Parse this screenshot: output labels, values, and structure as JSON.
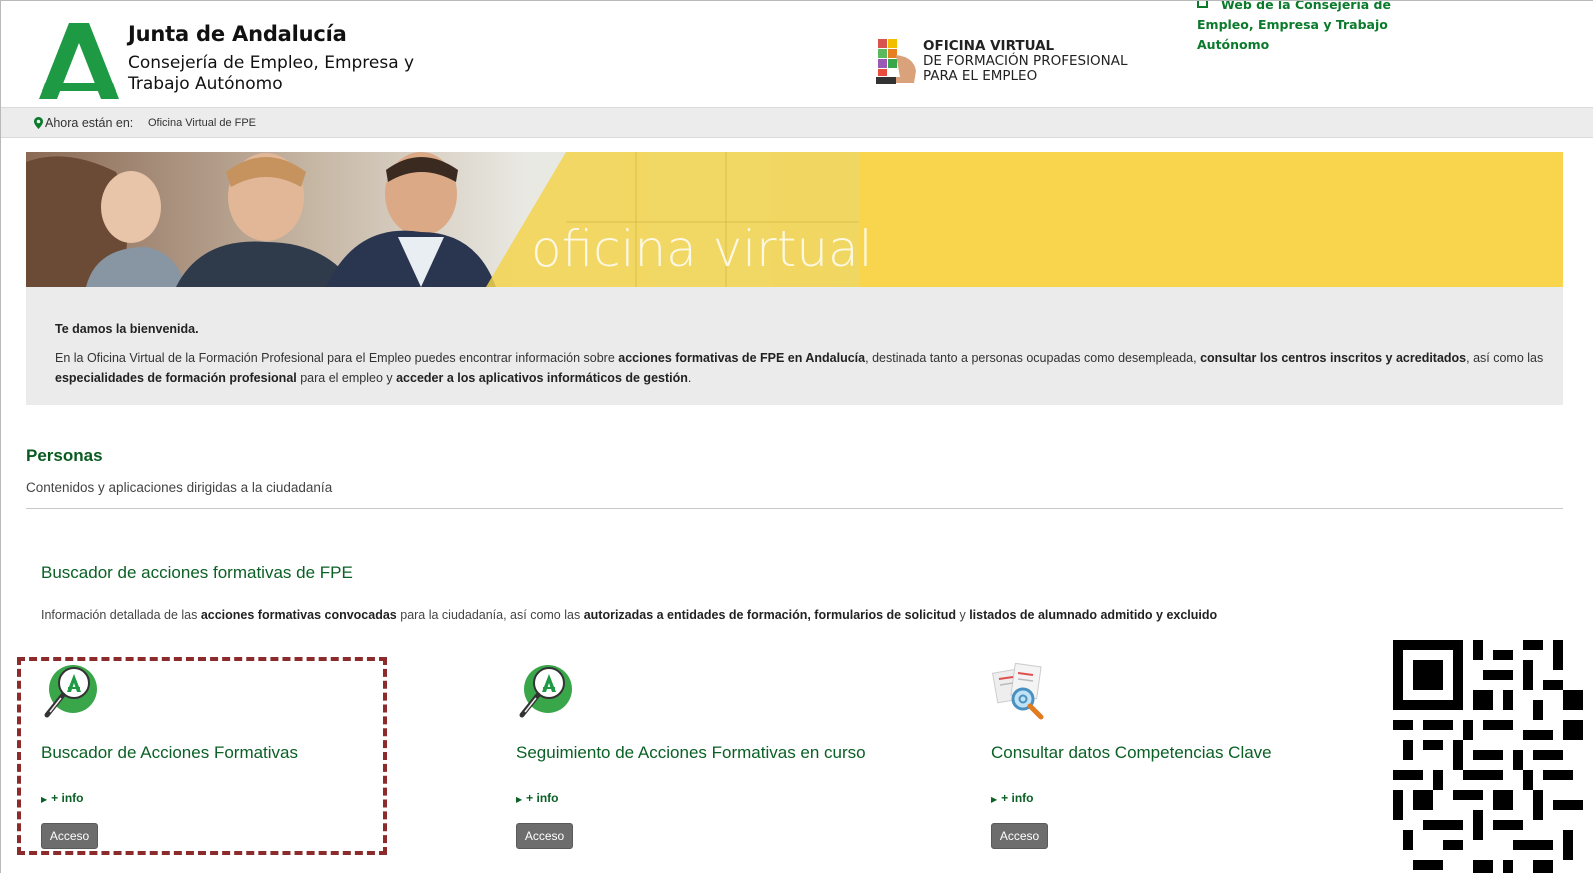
{
  "header": {
    "org_title": "Junta de Andalucía",
    "org_subtitle": "Consejería de Empleo, Empresa y Trabajo Autónomo",
    "office_line1": "OFICINA VIRTUAL",
    "office_line2": "DE FORMACIÓN PROFESIONAL",
    "office_line3": "PARA EL EMPLEO",
    "external_link": "Web de la Consejería de Empleo, Empresa y Trabajo Autónomo"
  },
  "breadcrumb": {
    "label": "Ahora están en:",
    "current": "Oficina Virtual de FPE"
  },
  "banner": {
    "text": "oficina virtual"
  },
  "welcome": {
    "title": "Te damos la bienvenida.",
    "p1": "En la Oficina Virtual de la Formación Profesional para el Empleo puedes encontrar información sobre ",
    "b1": "acciones formativas de FPE en Andalucía",
    "p2": ", destinada tanto a personas ocupadas como desempleada, ",
    "b2": "consultar los centros inscritos y acreditados",
    "p3": ", así como las ",
    "b3": "especialidades de formación profesional",
    "p4": " para el empleo y ",
    "b4": "acceder a los aplicativos informáticos de gestión",
    "p5": "."
  },
  "personas": {
    "title": "Personas",
    "subtitle": "Contenidos y aplicaciones dirigidas a la ciudadanía"
  },
  "section": {
    "title": "Buscador de acciones formativas de FPE",
    "d1": "Información detallada de las ",
    "b1": "acciones formativas convocadas",
    "d2": " para la ciudadanía, así como las ",
    "b2": "autorizadas a entidades de formación, formularios de solicitud",
    "d3": " y ",
    "b3": "listados de alumnado admitido y excluido"
  },
  "cards": [
    {
      "title": "Buscador de Acciones Formativas",
      "info": "+ info",
      "button": "Acceso"
    },
    {
      "title": "Seguimiento de Acciones Formativas en curso",
      "info": "+ info",
      "button": "Acceso"
    },
    {
      "title": "Consultar datos Competencias Clave",
      "info": "+ info",
      "button": "Acceso"
    }
  ],
  "colors": {
    "brand_green": "#0a6025",
    "banner_yellow": "#f9d54e",
    "highlight_border": "#8b2b2b"
  }
}
